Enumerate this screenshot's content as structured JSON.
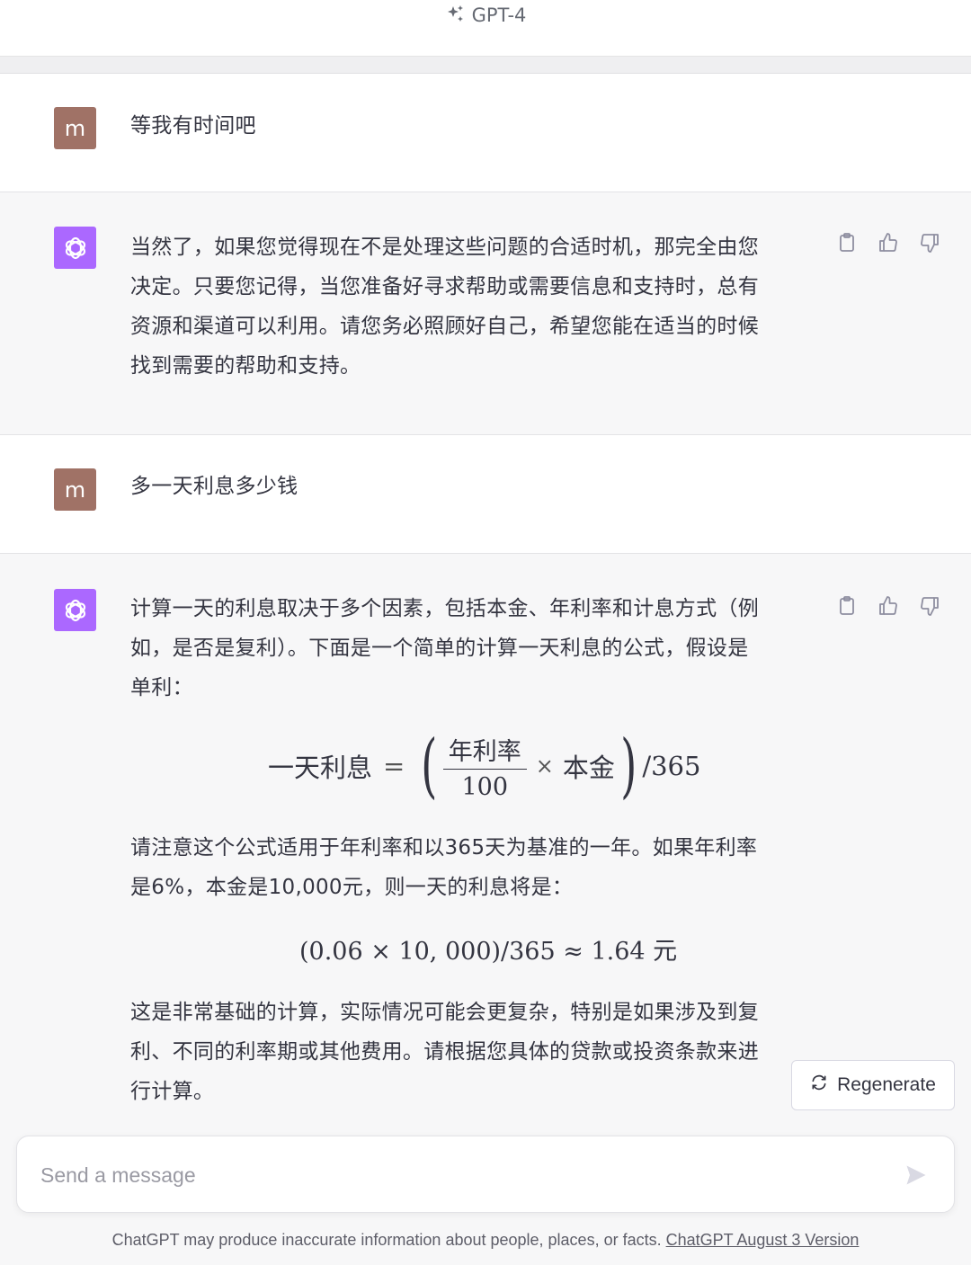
{
  "header": {
    "model_name": "GPT-4",
    "sparkle_icon": "sparkle-icon"
  },
  "messages": [
    {
      "role": "user",
      "avatar_letter": "m",
      "text": "等我有时间吧"
    },
    {
      "role": "assistant",
      "lines": [
        "当然了，如果您觉得现在不是处理这些问题的合适时机，那完全由您",
        "决定。只要您记得，当您准备好寻求帮助或需要信息和支持时，总有",
        "资源和渠道可以利用。请您务必照顾好自己，希望您能在适当的时候",
        "找到需要的帮助和支持。"
      ]
    },
    {
      "role": "user",
      "avatar_letter": "m",
      "text": "多一天利息多少钱"
    },
    {
      "role": "assistant",
      "intro_lines": [
        "计算一天的利息取决于多个因素，包括本金、年利率和计息方式（例",
        "如，是否是复利）。下面是一个简单的计算一天利息的公式，假设是",
        "单利："
      ],
      "formula": {
        "lhs": "一天利息",
        "equals": "=",
        "numerator": "年利率",
        "denominator": "100",
        "times": "×",
        "principal": "本金",
        "divisor": "/365"
      },
      "middle_lines": [
        "请注意这个公式适用于年利率和以365天为基准的一年。如果年利率",
        "是6%，本金是10,000元，则一天的利息将是："
      ],
      "example": "(0.06 × 10, 000)/365 ≈ 1.64 元",
      "closing_lines": [
        "这是非常基础的计算，实际情况可能会更复杂，特别是如果涉及到复",
        "利、不同的利率期或其他费用。请根据您具体的贷款或投资条款来进",
        "行计算。"
      ]
    }
  ],
  "actions": {
    "copy": "clipboard-icon",
    "like": "thumbs-up-icon",
    "dislike": "thumbs-down-icon"
  },
  "regenerate": {
    "label": "Regenerate",
    "icon": "refresh-icon"
  },
  "composer": {
    "placeholder": "Send a message",
    "send_icon": "send-icon"
  },
  "footer": {
    "disclaimer": "ChatGPT may produce inaccurate information about people, places, or facts.",
    "version_link": "ChatGPT August 3 Version"
  },
  "colors": {
    "user_avatar": "#a07266",
    "bot_avatar": "#ab68ff",
    "background": "#f7f7f8"
  }
}
